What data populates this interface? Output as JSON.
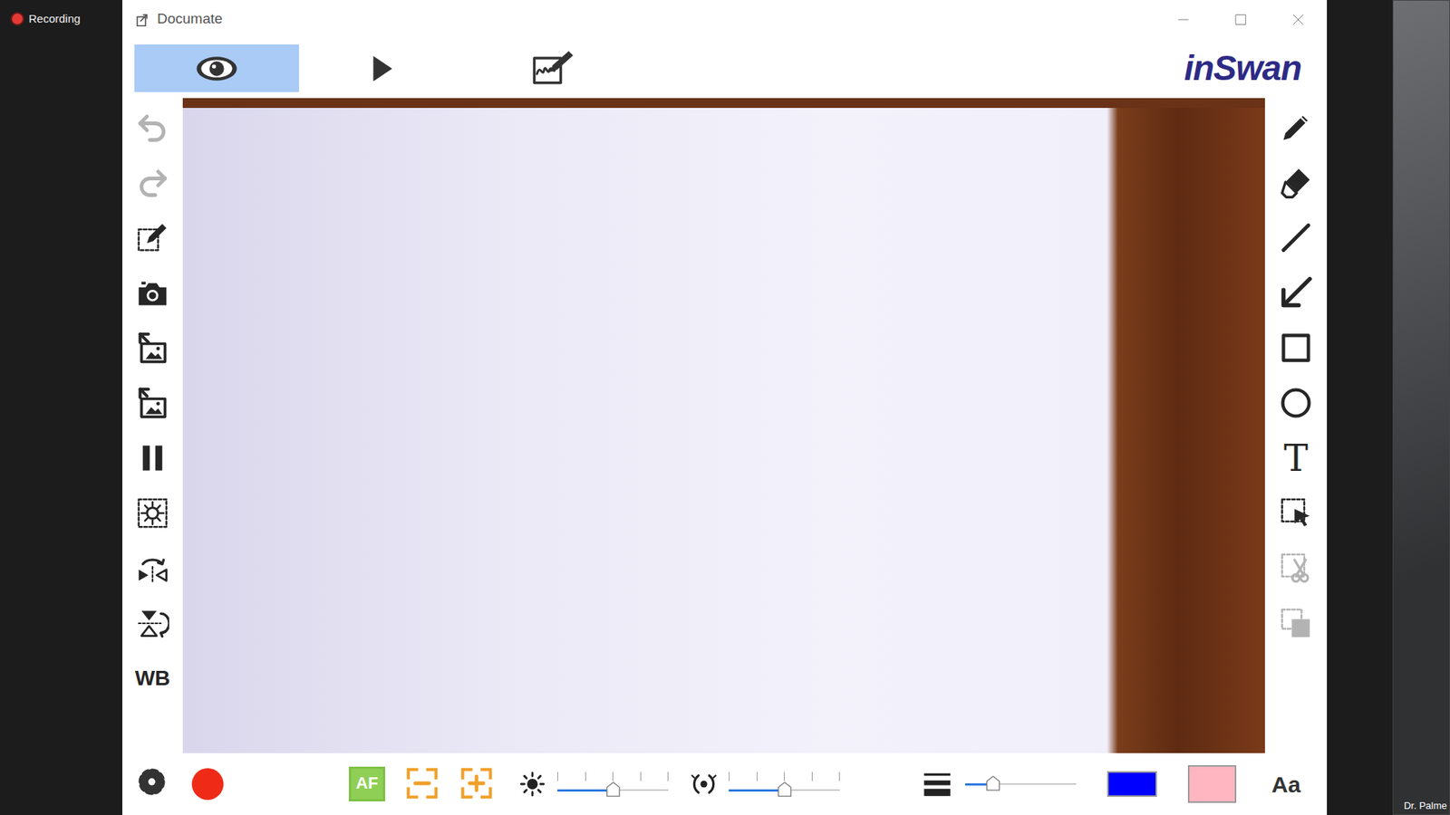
{
  "screen": {
    "recording": {
      "label": "Recording",
      "on": true
    },
    "participant": {
      "name": "Dr. Palme"
    }
  },
  "window": {
    "title": "Documate"
  },
  "toolbar": {
    "modes": [
      {
        "kind": "eye",
        "selected": true
      },
      {
        "kind": "play",
        "selected": false
      },
      {
        "kind": "sign",
        "selected": false
      }
    ],
    "logo": "inSwan"
  },
  "left_tools": [
    {
      "kind": "undo",
      "disabled": true
    },
    {
      "kind": "redo",
      "disabled": true
    },
    {
      "kind": "edit",
      "disabled": false
    },
    {
      "kind": "camera",
      "disabled": false
    },
    {
      "kind": "import",
      "disabled": false
    },
    {
      "kind": "export",
      "disabled": false
    },
    {
      "kind": "pause",
      "disabled": false
    },
    {
      "kind": "timer",
      "disabled": false
    },
    {
      "kind": "mirror",
      "disabled": false
    },
    {
      "kind": "flip",
      "disabled": false
    },
    {
      "kind": "label",
      "label": "WB",
      "disabled": false
    }
  ],
  "right_tools": [
    {
      "kind": "pencil",
      "disabled": false
    },
    {
      "kind": "eraser",
      "disabled": false
    },
    {
      "kind": "line",
      "disabled": false
    },
    {
      "kind": "arrow",
      "disabled": false
    },
    {
      "kind": "rect",
      "disabled": false
    },
    {
      "kind": "circle",
      "disabled": false
    },
    {
      "kind": "label",
      "label": "T",
      "disabled": false
    },
    {
      "kind": "select",
      "disabled": false
    },
    {
      "kind": "cut",
      "disabled": true
    },
    {
      "kind": "copy",
      "disabled": true
    }
  ],
  "bottom_bar": {
    "autofocus": "AF",
    "sliders": [
      {
        "kind": "brightness",
        "level": 0.5
      },
      {
        "kind": "focus",
        "level": 0.5
      },
      {
        "kind": "line-width",
        "level": 0.25
      }
    ],
    "swatches": [
      {
        "color": "#0000ff"
      },
      {
        "color": "#ffb6c1"
      }
    ],
    "font_button": "Aa"
  }
}
